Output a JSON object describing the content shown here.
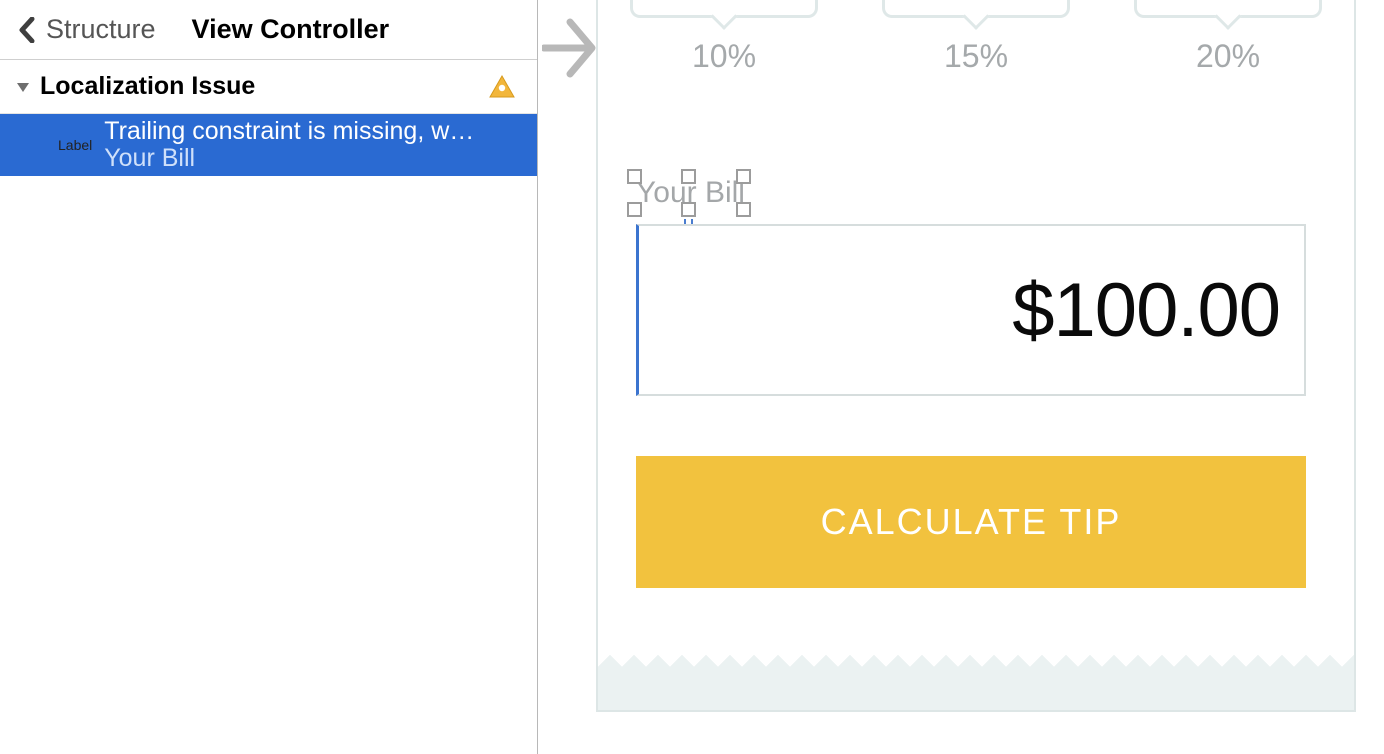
{
  "sidebar": {
    "back_label": "Structure",
    "title": "View Controller",
    "group_label": "Localization Issue",
    "issue": {
      "chip": "Label",
      "title": "Trailing constraint is missing, w…",
      "subtitle": "Your Bill"
    }
  },
  "canvas": {
    "percentages": [
      "10%",
      "15%",
      "20%"
    ],
    "bill_label": "Your Bill",
    "bill_amount": "$100.00",
    "calc_button": "CALCULATE TIP"
  },
  "colors": {
    "selection_blue": "#2a6ad2",
    "button_yellow": "#f2c23e",
    "muted_text": "#a5a9ab",
    "border_soft": "#dde6e6"
  }
}
